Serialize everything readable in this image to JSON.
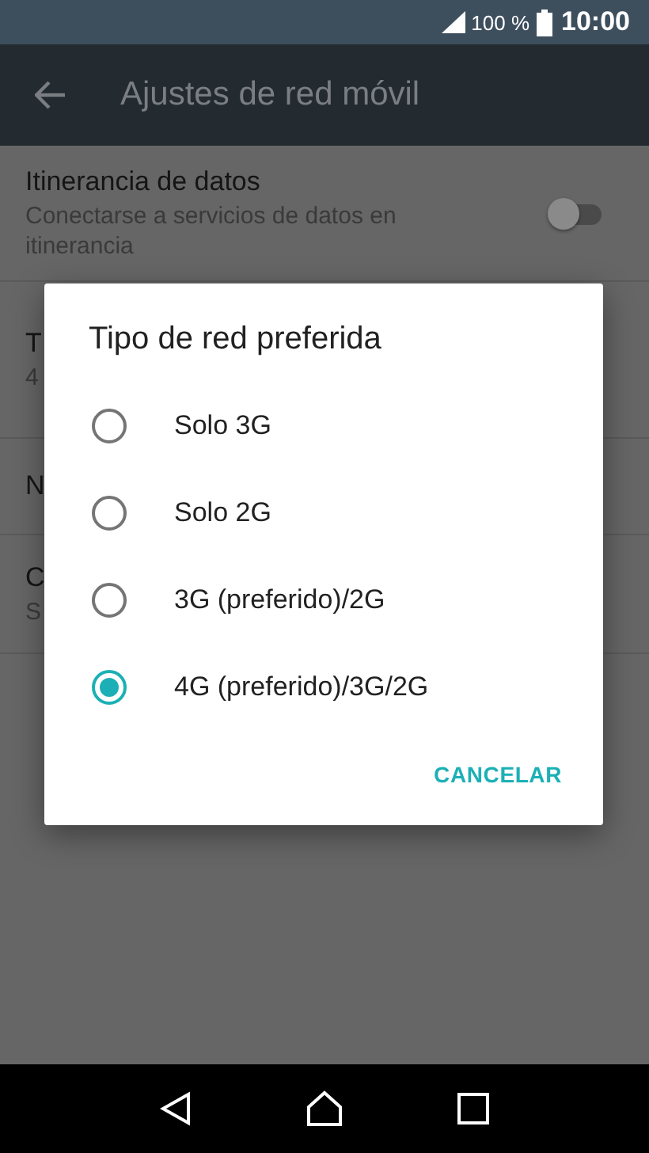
{
  "status_bar": {
    "battery": "100 %",
    "time": "10:00"
  },
  "app_bar": {
    "title": "Ajustes de red móvil"
  },
  "settings": [
    {
      "title": "Itinerancia de datos",
      "subtitle": "Conectarse a servicios de datos en itinerancia",
      "kind": "toggle",
      "on": false
    },
    {
      "title": "T",
      "subtitle": "4",
      "kind": "plain"
    },
    {
      "title": "N",
      "kind": "plain"
    },
    {
      "title": "C",
      "subtitle": "S",
      "kind": "plain"
    }
  ],
  "dialog": {
    "title": "Tipo de red preferida",
    "options": [
      {
        "label": "Solo 3G",
        "selected": false
      },
      {
        "label": "Solo 2G",
        "selected": false
      },
      {
        "label": "3G (preferido)/2G",
        "selected": false
      },
      {
        "label": "4G (preferido)/3G/2G",
        "selected": true
      }
    ],
    "buttons": [
      "CANCELAR"
    ]
  }
}
